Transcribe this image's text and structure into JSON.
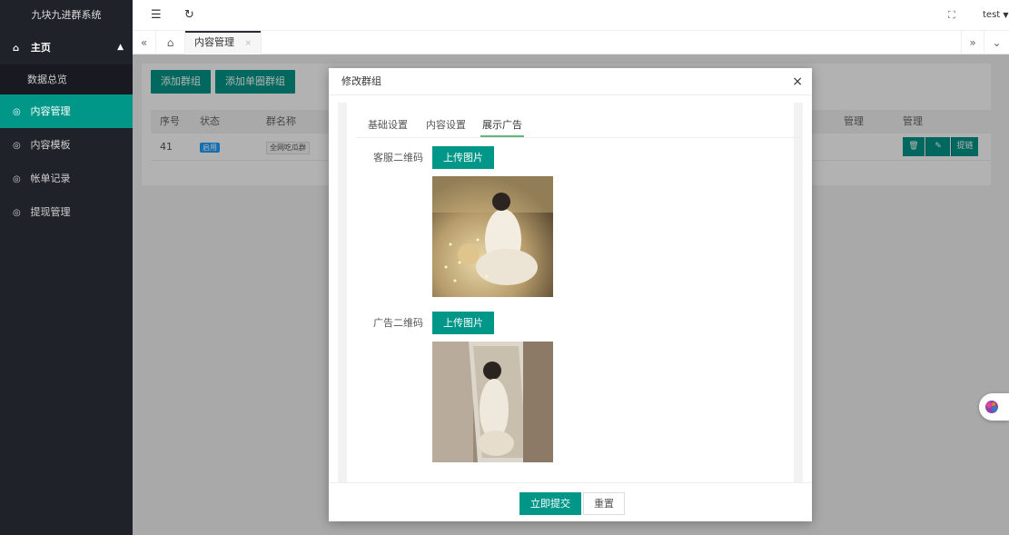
{
  "app": {
    "title": "九块九进群系统"
  },
  "sidebar": {
    "home_label": "主页",
    "sub_items": [
      {
        "label": "数据总览"
      }
    ],
    "items": [
      {
        "label": "内容管理",
        "active": true
      },
      {
        "label": "内容模板",
        "active": false
      },
      {
        "label": "帐单记录",
        "active": false
      },
      {
        "label": "提现管理",
        "active": false
      }
    ]
  },
  "header": {
    "user": "test"
  },
  "tabs": {
    "active_label": "内容管理",
    "close": "×"
  },
  "toolbar": {
    "add_group": "添加群组",
    "add_single_group": "添加单圈群组"
  },
  "table": {
    "headers": [
      "序号",
      "状态",
      "群名称",
      "管理",
      "管理"
    ],
    "rows": [
      {
        "id": "41",
        "status": "启用",
        "name": "全网吃瓜群",
        "action_link": "提链"
      }
    ]
  },
  "modal": {
    "title": "修改群组",
    "close": "×",
    "tabs": [
      "基础设置",
      "内容设置",
      "展示广告"
    ],
    "active_tab": 2,
    "fields": [
      {
        "label": "客服二维码",
        "button": "上传图片"
      },
      {
        "label": "广告二维码",
        "button": "上传图片"
      }
    ],
    "submit": "立即提交",
    "reset": "重置"
  },
  "colors": {
    "accent": "#009688",
    "sidebar_bg": "#20222a",
    "badge_blue": "#1e9fff"
  }
}
